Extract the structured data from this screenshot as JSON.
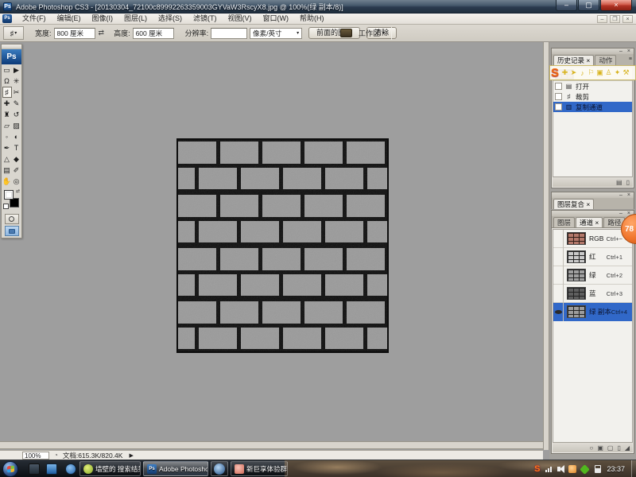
{
  "app": {
    "title": "Adobe Photoshop CS3 - [20130304_72100c89992263359003GYVaW3RscyX8.jpg @ 100%(绿 副本/8)]",
    "logo": "Ps"
  },
  "glyphs": {
    "minimize": "–",
    "maximize": "▢",
    "restore": "❐",
    "close": "×",
    "menu": "≡",
    "arrow_down": "▾",
    "swap": "⇄",
    "play": "▶",
    "timer": "◔",
    "grip": "◢"
  },
  "menu": {
    "items": [
      "文件(F)",
      "编辑(E)",
      "图像(I)",
      "图层(L)",
      "选择(S)",
      "滤镜(T)",
      "视图(V)",
      "窗口(W)",
      "帮助(H)"
    ]
  },
  "options_bar": {
    "width_label": "宽度:",
    "width_value": "800 厘米",
    "height_label": "高度:",
    "height_value": "600 厘米",
    "resolution_label": "分辨率:",
    "resolution_value": "",
    "unit_value": "像素/英寸",
    "front_image_button": "前面的图像",
    "clear_button": "清除",
    "workspace_button": "工作区"
  },
  "toolbox": {
    "logo": "Ps",
    "tools": [
      {
        "name": "rectangular-marquee",
        "glyph": "▭"
      },
      {
        "name": "move",
        "glyph": "▶"
      },
      {
        "name": "lasso",
        "glyph": "Ω"
      },
      {
        "name": "magic-wand",
        "glyph": "✳"
      },
      {
        "name": "crop",
        "glyph": "♯",
        "selected": true
      },
      {
        "name": "slice",
        "glyph": "✂"
      },
      {
        "name": "healing-brush",
        "glyph": "✚"
      },
      {
        "name": "brush",
        "glyph": "✎"
      },
      {
        "name": "clone-stamp",
        "glyph": "♜"
      },
      {
        "name": "history-brush",
        "glyph": "↺"
      },
      {
        "name": "eraser",
        "glyph": "▱"
      },
      {
        "name": "gradient",
        "glyph": "▨"
      },
      {
        "name": "blur",
        "glyph": "◦"
      },
      {
        "name": "dodge",
        "glyph": "◐"
      },
      {
        "name": "pen",
        "glyph": "✒"
      },
      {
        "name": "type",
        "glyph": "T"
      },
      {
        "name": "path-selection",
        "glyph": "△"
      },
      {
        "name": "shape",
        "glyph": "◆"
      },
      {
        "name": "notes",
        "glyph": "▤"
      },
      {
        "name": "eyedropper",
        "glyph": "✐"
      },
      {
        "name": "hand",
        "glyph": "✋"
      },
      {
        "name": "zoom",
        "glyph": "◎"
      }
    ]
  },
  "history_panel": {
    "tabs": [
      "历史记录",
      "动作"
    ],
    "items": [
      {
        "icon": "▤",
        "label": "打开"
      },
      {
        "icon": "♯",
        "label": "裁剪"
      },
      {
        "icon": "▥",
        "label": "复制通道",
        "selected": true
      }
    ]
  },
  "overlay_toolbar": {
    "logo": "S",
    "icons": [
      "✚",
      "➤",
      "♪",
      "⚐",
      "▣",
      "♙",
      "✦",
      "⚒"
    ]
  },
  "layer_comps_panel": {
    "tab": "图层复合"
  },
  "channels_panel": {
    "tabs": [
      "图层",
      "通道",
      "路径"
    ],
    "active_tab": "通道",
    "channels": [
      {
        "name": "RGB",
        "shortcut": "Ctrl+~",
        "thumb_color": "#b3786a",
        "visible": false,
        "selected": false
      },
      {
        "name": "红",
        "shortcut": "Ctrl+1",
        "thumb_color": "#c9c9c9",
        "visible": false,
        "selected": false
      },
      {
        "name": "绿",
        "shortcut": "Ctrl+2",
        "thumb_color": "#a0a0a0",
        "visible": false,
        "selected": false
      },
      {
        "name": "蓝",
        "shortcut": "Ctrl+3",
        "thumb_color": "#5f5f5f",
        "visible": false,
        "selected": false
      },
      {
        "name": "绿 副本",
        "shortcut": "Ctrl+4",
        "thumb_color": "#9c9c9c",
        "visible": true,
        "selected": true
      }
    ],
    "footer_icons": [
      {
        "name": "load-selection",
        "glyph": "○"
      },
      {
        "name": "save-selection",
        "glyph": "▣"
      },
      {
        "name": "new-channel",
        "glyph": "▢"
      },
      {
        "name": "delete-channel",
        "glyph": "▯"
      }
    ]
  },
  "history_footer_icons": [
    {
      "name": "new-snapshot",
      "glyph": "▤"
    },
    {
      "name": "delete-state",
      "glyph": "▯"
    }
  ],
  "status_bar": {
    "zoom": "100%",
    "doc_label": "文档:615.3K/820.4K"
  },
  "taskbar": {
    "buttons": [
      {
        "label": "墙壁的 搜索结果_36..."
      },
      {
        "label": "Adobe Photoshop ...",
        "active": true
      },
      {
        "label": ""
      },
      {
        "label": "新巨享体验群等3个..."
      }
    ],
    "tray_s": "S",
    "clock": "23:37"
  },
  "overlay_ball": {
    "value": "78"
  },
  "colors": {
    "canvas_gray": "#9e9e9e",
    "brick_gray": "#9a9a9a",
    "mortar_black": "#0d0d0d",
    "selection_blue": "#3168c8",
    "ball_orange": "#f0752c",
    "s_logo_orange": "#f06a10",
    "overlay_icon_yellow": "#d8b421"
  }
}
